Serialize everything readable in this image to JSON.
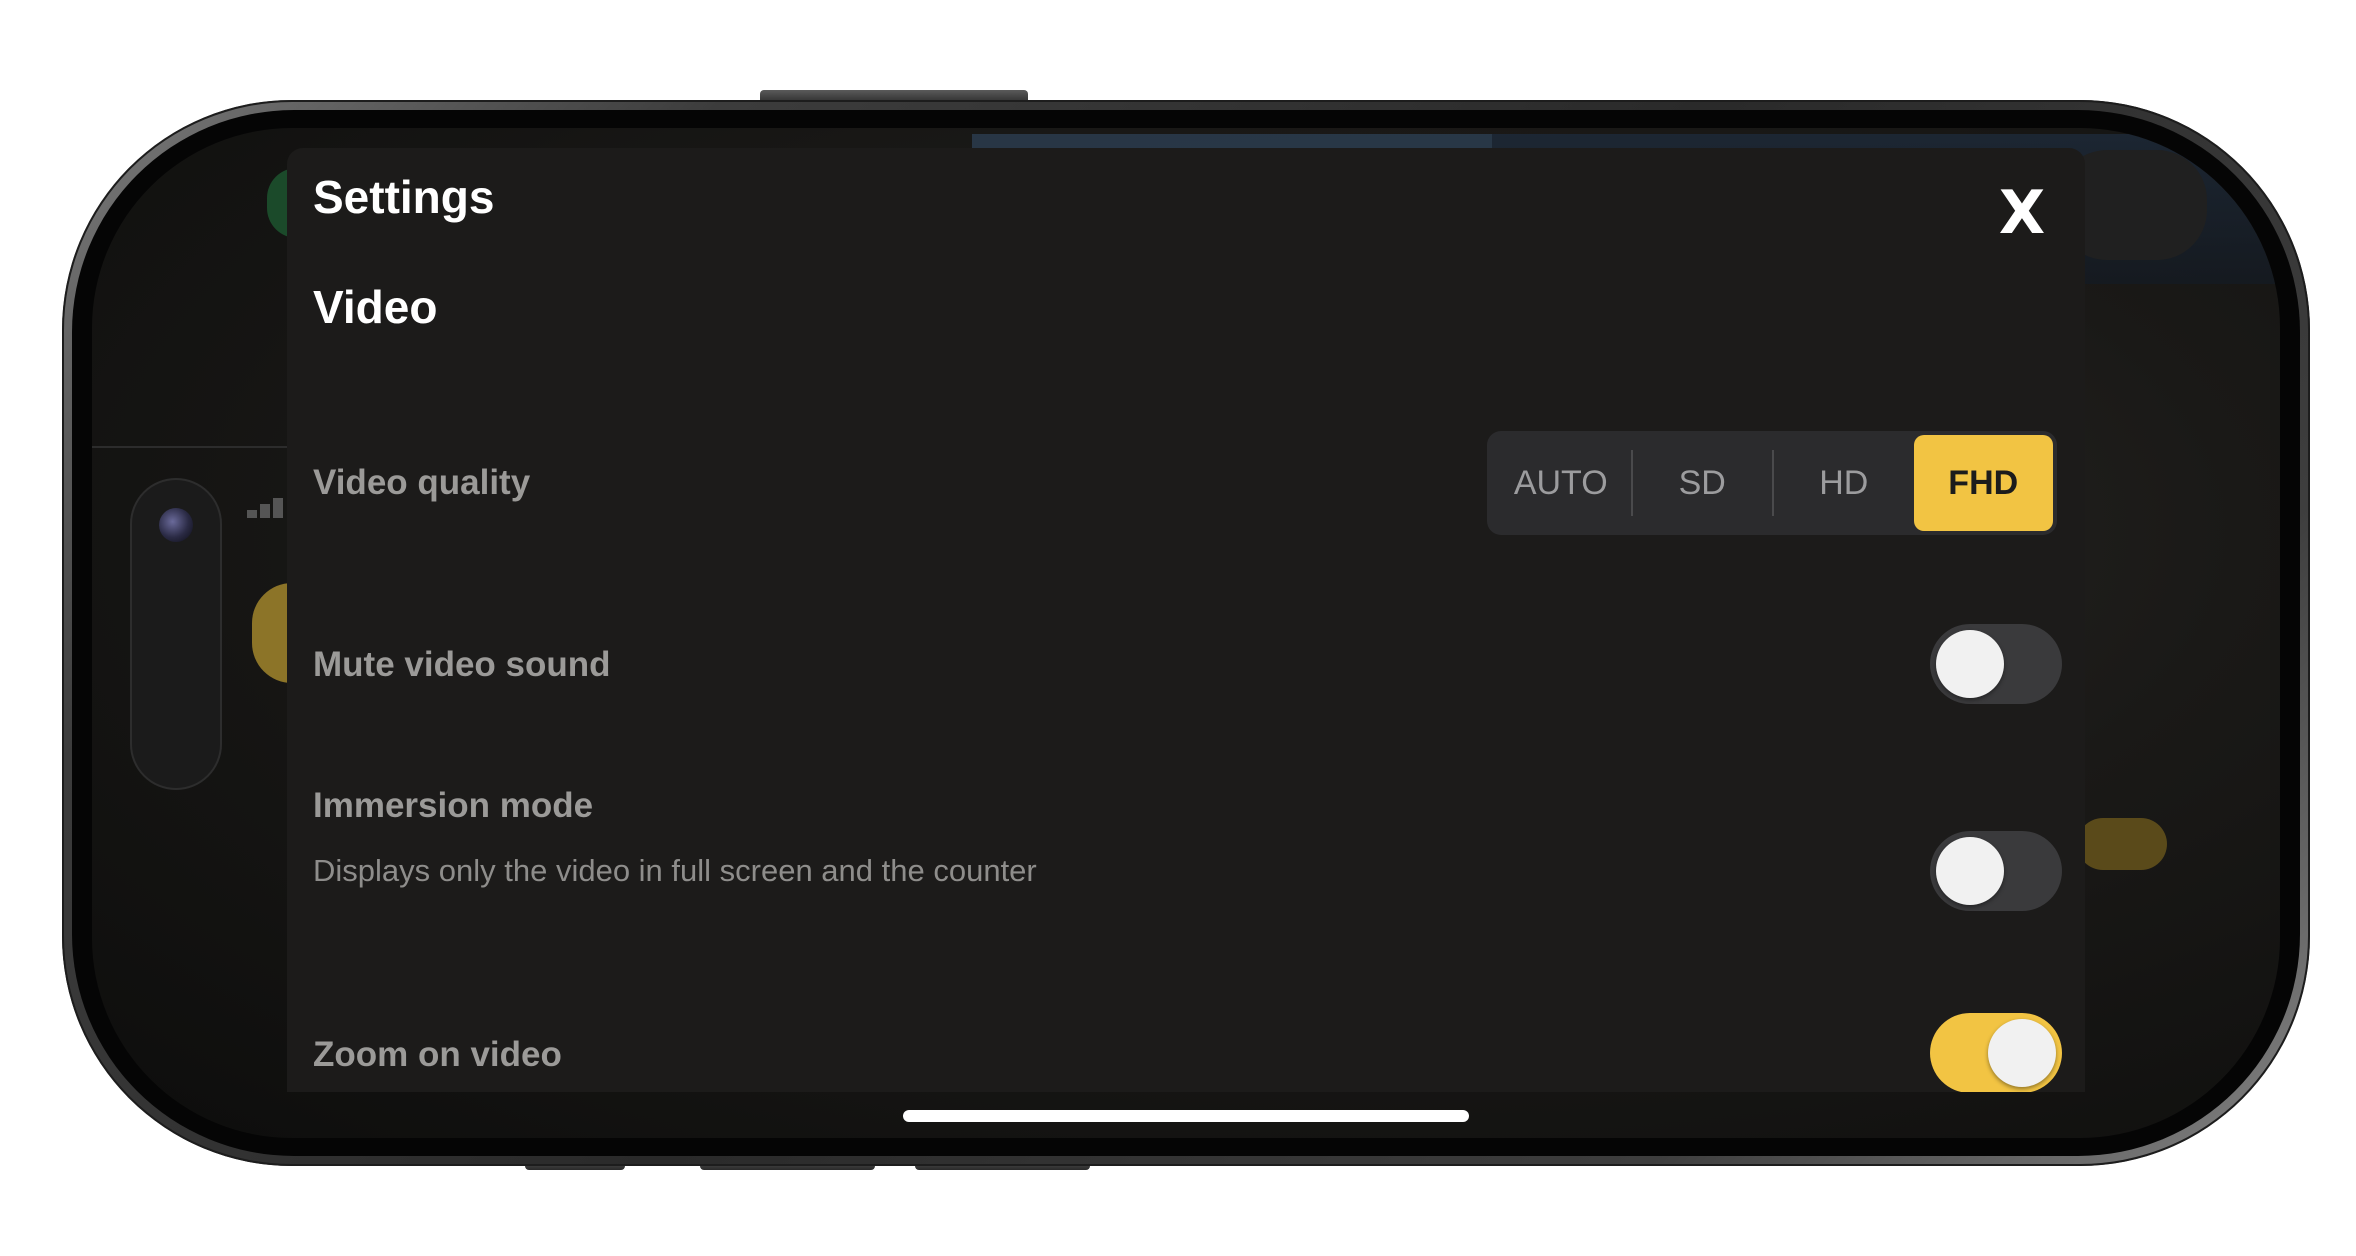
{
  "modal": {
    "title": "Settings",
    "close_label": "X",
    "section_title": "Video"
  },
  "video_quality": {
    "label": "Video quality",
    "options": [
      "AUTO",
      "SD",
      "HD",
      "FHD"
    ],
    "selected": "FHD"
  },
  "mute_video_sound": {
    "label": "Mute video sound",
    "enabled": false
  },
  "immersion_mode": {
    "label": "Immersion mode",
    "description": "Displays only the video in full screen and the counter",
    "enabled": false
  },
  "zoom_on_video": {
    "label": "Zoom on video",
    "enabled": true
  },
  "colors": {
    "accent": "#f2c443",
    "modal_background": "#1c1b1a",
    "toggle_off": "#3a3a3c"
  }
}
